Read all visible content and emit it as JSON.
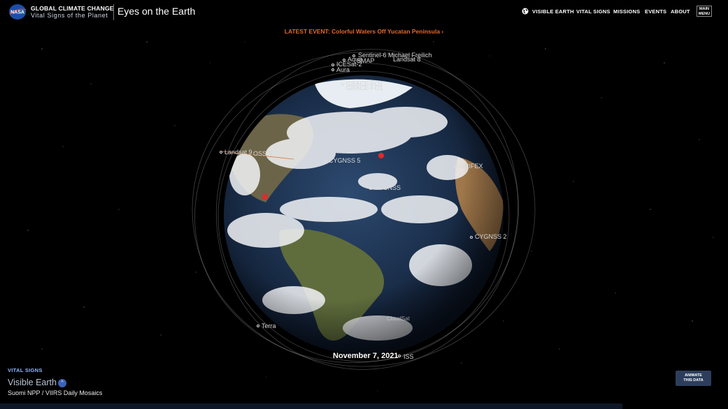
{
  "header": {
    "org_title": "GLOBAL CLIMATE CHANGE",
    "org_subtitle": "Vital Signs of the Planet",
    "app_title": "Eyes on the Earth",
    "nav": [
      "VISIBLE EARTH",
      "VITAL SIGNS",
      "MISSIONS",
      "EVENTS",
      "ABOUT"
    ],
    "menu_label_1": "MAIN",
    "menu_label_2": "MENU",
    "logo_text": "NASA"
  },
  "latest_event": "LATEST EVENT: Colorful Waters Off Yucatan Peninsula ›",
  "satellites": [
    "Sentinel-6 Michael Freilich",
    "Landsat 8",
    "Aqua",
    "SMAP",
    "ICESat-2",
    "Aura",
    "GRACE-FO2",
    "GRACE-FO1",
    "Landsat 9",
    "OSS 3",
    "CYGNSS 5",
    "CYGNSS",
    "GRIFEX",
    "CYGNSS 2",
    "Terra",
    "CloudSat",
    "Cal"
  ],
  "date": "November 7, 2021",
  "iss_label": "ISS",
  "panel": {
    "caption": "VITAL SIGNS",
    "title": "Visible Earth",
    "chevron": "^",
    "dataset": "Suomi NPP / VIIRS Daily Mosaics"
  },
  "animate_button": [
    "ANIMATE",
    "THIS DATA"
  ],
  "colors": {
    "accent": "#e4682a",
    "link_blue": "#8fb8ff",
    "button_bg": "#2d3e5c"
  }
}
